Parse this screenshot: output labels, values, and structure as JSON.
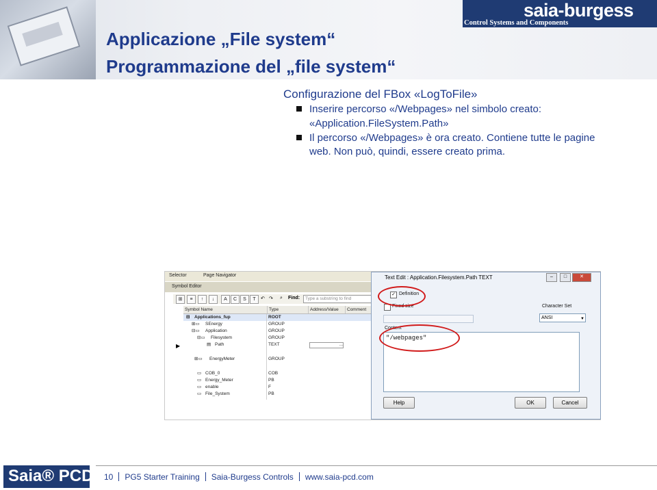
{
  "header": {
    "logo": "saia-burgess",
    "logo_sub": "Control Systems and Components",
    "title_line1": "Applicazione „File system“",
    "title_line2": "Programmazione del „file system“"
  },
  "content": {
    "section_title": "Configurazione del FBox «LogToFile»",
    "bullet1_line1": "Inserire percorso «/Webpages» nel simbolo creato:",
    "bullet1_line2": "«Application.FileSystem.Path»",
    "bullet2_line1": "Il percorso «/Webpages» è ora creato. Contiene tutte le pagine",
    "bullet2_line2": "web. Non può, quindi, essere creato prima."
  },
  "symbol_editor": {
    "tab_selector": "Selector",
    "tab_navigator": "Page Navigator",
    "title": "Symbol Editor",
    "filter_buttons": [
      "A",
      "C",
      "S",
      "T"
    ],
    "find_label": "Find:",
    "find_placeholder": "Type a substring to find",
    "columns": [
      "Symbol Name",
      "Type",
      "Address/Value",
      "Comment"
    ],
    "rows": [
      {
        "name": "Applications_fup",
        "type": "ROOT",
        "addr": ""
      },
      {
        "name": "SEnergy",
        "type": "GROUP",
        "addr": ""
      },
      {
        "name": "Application",
        "type": "GROUP",
        "addr": ""
      },
      {
        "name": "Filesystem",
        "type": "GROUP",
        "addr": ""
      },
      {
        "name": "Path",
        "type": "TEXT",
        "addr": "..."
      },
      {
        "name": "",
        "type": "",
        "addr": ""
      },
      {
        "name": "EnergyMeter",
        "type": "GROUP",
        "addr": ""
      },
      {
        "name": "",
        "type": "",
        "addr": ""
      },
      {
        "name": "COB_0",
        "type": "COB",
        "addr": ""
      },
      {
        "name": "Energy_Meter",
        "type": "PB",
        "addr": ""
      },
      {
        "name": "enable",
        "type": "F",
        "addr": ""
      },
      {
        "name": "File_System",
        "type": "PB",
        "addr": ""
      }
    ]
  },
  "text_edit": {
    "title": "Text Edit : Application.Filesystem.Path TEXT",
    "definition_label": "Definition",
    "fixed_size_label": "Fixed size",
    "charset_label": "Character Set",
    "charset_value": "ANSI",
    "content_label": "Content",
    "content_value": "\"/webpages\"",
    "help_button": "Help",
    "ok_button": "OK",
    "cancel_button": "Cancel"
  },
  "footer": {
    "logo": "Saia® PCD",
    "page": "10",
    "course": "PG5 Starter Training",
    "company": "Saia-Burgess Controls",
    "url": "www.saia-pcd.com"
  },
  "colors": {
    "title": "#1f3b8c",
    "brand": "#1f3b73",
    "highlight": "#d11a1a"
  }
}
